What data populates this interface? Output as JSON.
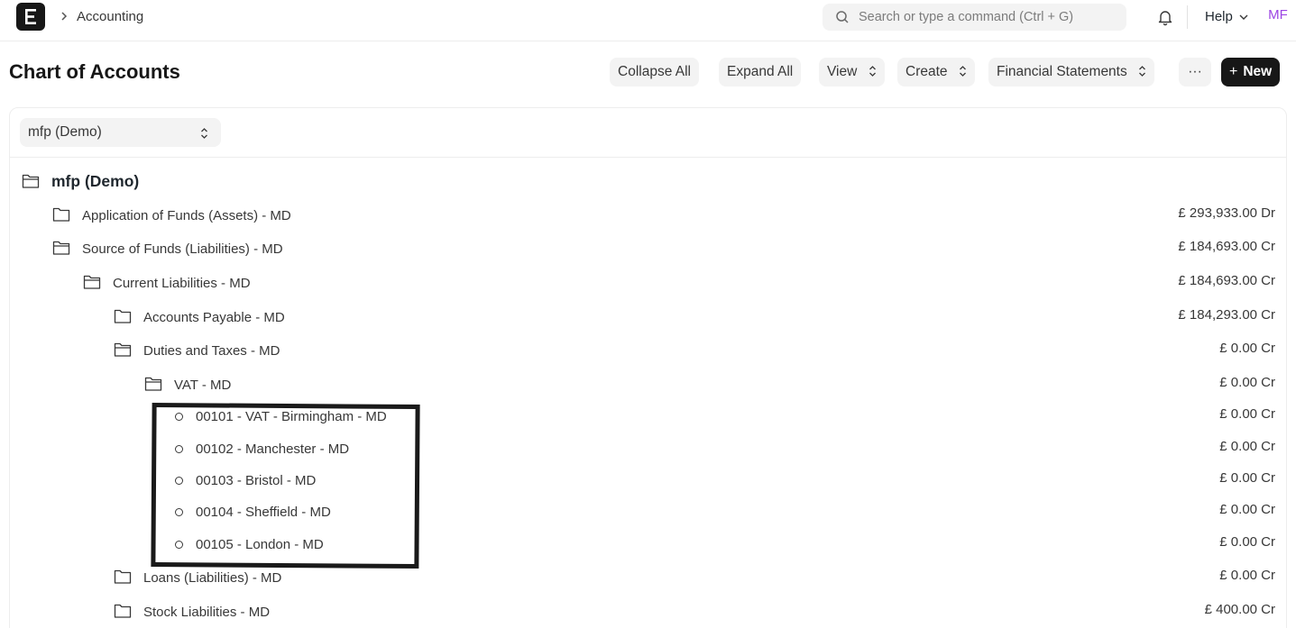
{
  "navbar": {
    "breadcrumb": "Accounting",
    "search_placeholder": "Search or type a command (Ctrl + G)",
    "help_label": "Help",
    "avatar_initials": "MF"
  },
  "page": {
    "title": "Chart of Accounts",
    "buttons": {
      "collapse_all": "Collapse All",
      "expand_all": "Expand All",
      "view": "View",
      "create": "Create",
      "financial_statements": "Financial Statements",
      "more": "···",
      "new": "New"
    }
  },
  "company_select": {
    "value": "mfp (Demo)"
  },
  "tree": {
    "root": "mfp (Demo)",
    "accounts": [
      {
        "label": "Application of Funds (Assets) - MD",
        "balance": "£ 293,933.00 Dr",
        "type": "folder-closed"
      },
      {
        "label": "Source of Funds (Liabilities) - MD",
        "balance": "£ 184,693.00 Cr",
        "type": "folder-open"
      },
      {
        "label": "Current Liabilities - MD",
        "balance": "£ 184,693.00 Cr",
        "type": "folder-open"
      },
      {
        "label": "Accounts Payable - MD",
        "balance": "£ 184,293.00 Cr",
        "type": "folder-closed"
      },
      {
        "label": "Duties and Taxes - MD",
        "balance": "£ 0.00 Cr",
        "type": "folder-open"
      },
      {
        "label": "VAT - MD",
        "balance": "£ 0.00 Cr",
        "type": "folder-open"
      },
      {
        "label": "00101 - VAT - Birmingham - MD",
        "balance": "£ 0.00 Cr",
        "type": "leaf"
      },
      {
        "label": "00102 - Manchester - MD",
        "balance": "£ 0.00 Cr",
        "type": "leaf"
      },
      {
        "label": "00103 - Bristol - MD",
        "balance": "£ 0.00 Cr",
        "type": "leaf"
      },
      {
        "label": "00104 - Sheffield - MD",
        "balance": "£ 0.00 Cr",
        "type": "leaf"
      },
      {
        "label": "00105 - London - MD",
        "balance": "£ 0.00 Cr",
        "type": "leaf"
      },
      {
        "label": "Loans (Liabilities) - MD",
        "balance": "£ 0.00 Cr",
        "type": "folder-closed"
      },
      {
        "label": "Stock Liabilities - MD",
        "balance": "£ 400.00 Cr",
        "type": "folder-closed"
      }
    ]
  }
}
